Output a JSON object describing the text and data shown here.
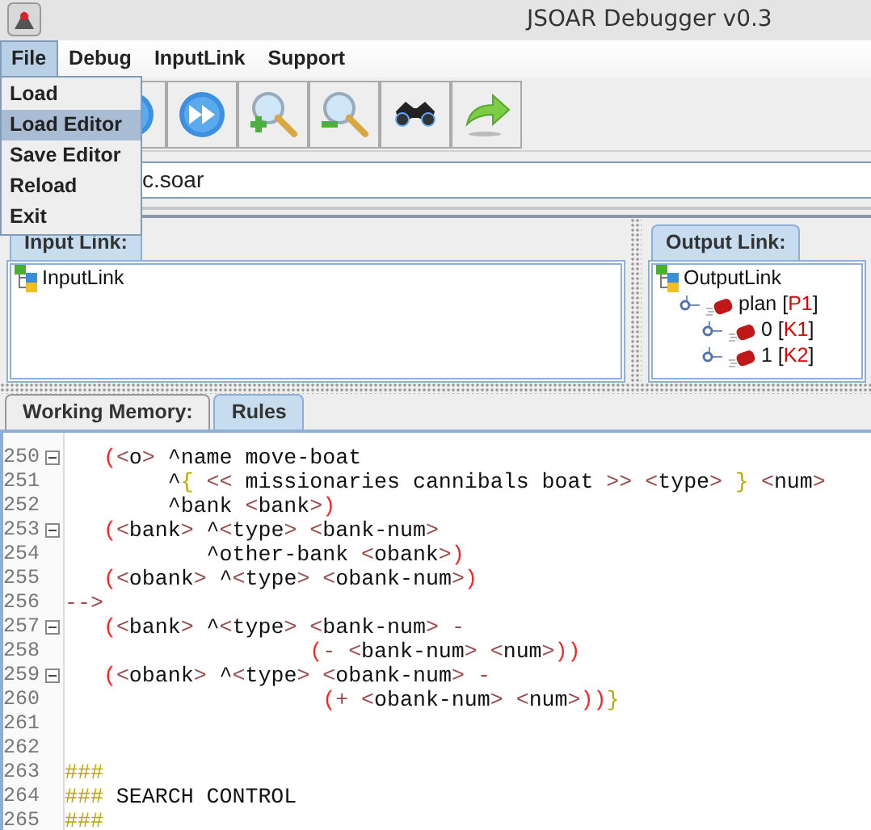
{
  "window": {
    "title": "JSOAR Debugger v0.3"
  },
  "menu_bar": [
    {
      "label": "File",
      "selected": true
    },
    {
      "label": "Debug",
      "selected": false
    },
    {
      "label": "InputLink",
      "selected": false
    },
    {
      "label": "Support",
      "selected": false
    }
  ],
  "file_menu": [
    {
      "label": "Load",
      "selected": false
    },
    {
      "label": "Load Editor",
      "selected": true
    },
    {
      "label": "Save Editor",
      "selected": false
    },
    {
      "label": "Reload",
      "selected": false
    },
    {
      "label": "Exit",
      "selected": false
    }
  ],
  "toolbar": [
    {
      "kind": "play"
    },
    {
      "kind": "fast-forward"
    },
    {
      "kind": "zoom-in"
    },
    {
      "kind": "zoom-out"
    },
    {
      "kind": "binoculars"
    },
    {
      "kind": "forward"
    }
  ],
  "file_field": {
    "value": "c.soar"
  },
  "input_link": {
    "tab": "Input Link:",
    "tree": [
      {
        "label": "InputLink",
        "kind": "root"
      }
    ]
  },
  "output_link": {
    "tab": "Output Link:",
    "tree": [
      {
        "label": "OutputLink",
        "kind": "root",
        "children": [
          {
            "label": "plan",
            "id": "[P1]",
            "kind": "node",
            "children": [
              {
                "label": "0",
                "id": "[K1]",
                "kind": "node"
              },
              {
                "label": "1",
                "id": "[K2]",
                "kind": "node"
              }
            ]
          }
        ]
      }
    ]
  },
  "bottom_tabs": [
    {
      "label": "Working Memory:",
      "selected": false
    },
    {
      "label": "Rules",
      "selected": true
    }
  ],
  "editor": {
    "lines": [
      {
        "number": "250",
        "foldable": true,
        "text": "   (<o> ^name move-boat"
      },
      {
        "number": "251",
        "foldable": false,
        "text": "        ^{ << missionaries cannibals boat >> <type> } <num>"
      },
      {
        "number": "252",
        "foldable": false,
        "text": "        ^bank <bank>)"
      },
      {
        "number": "253",
        "foldable": true,
        "text": "   (<bank> ^<type> <bank-num>"
      },
      {
        "number": "254",
        "foldable": false,
        "text": "           ^other-bank <obank>)"
      },
      {
        "number": "255",
        "foldable": false,
        "text": "   (<obank> ^<type> <obank-num>)"
      },
      {
        "number": "256",
        "foldable": false,
        "text": "-->"
      },
      {
        "number": "257",
        "foldable": true,
        "text": "   (<bank> ^<type> <bank-num> -"
      },
      {
        "number": "258",
        "foldable": false,
        "text": "                   (- <bank-num> <num>))"
      },
      {
        "number": "259",
        "foldable": true,
        "text": "   (<obank> ^<type> <obank-num> -"
      },
      {
        "number": "260",
        "foldable": false,
        "text": "                    (+ <obank-num> <num>))}"
      },
      {
        "number": "261",
        "foldable": false
      },
      {
        "number": "262",
        "foldable": false
      },
      {
        "number": "263",
        "foldable": false,
        "text": "###"
      },
      {
        "number": "264",
        "foldable": false,
        "text": "### SEARCH CONTROL"
      },
      {
        "number": "265",
        "foldable": false,
        "text": "###"
      }
    ]
  }
}
